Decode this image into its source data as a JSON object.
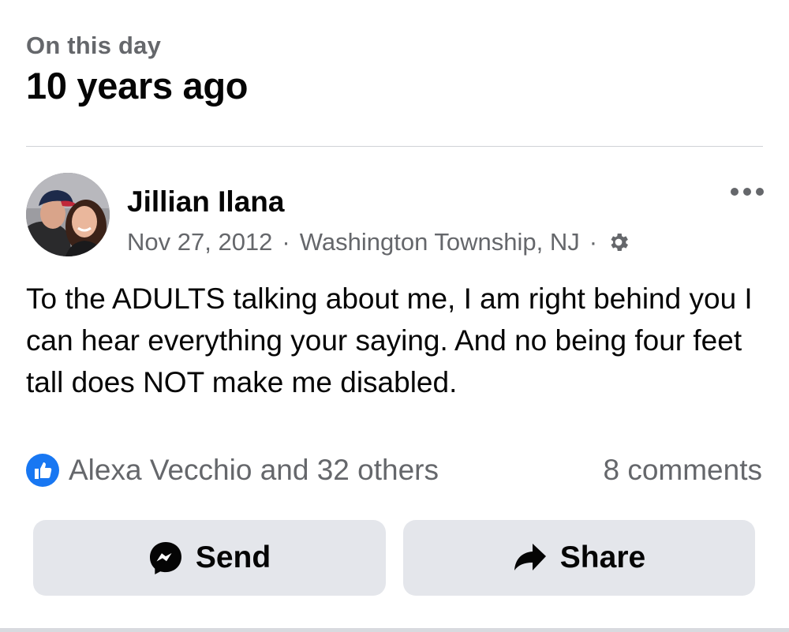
{
  "memory": {
    "kicker": "On this day",
    "title": "10 years ago"
  },
  "post": {
    "author": "Jillian Ilana",
    "date": "Nov 27, 2012",
    "location": "Washington Township, NJ",
    "separator": "·",
    "audience_icon": "gear-icon",
    "text": "To the ADULTS talking about me, I am right behind you I can hear everything your saying. And no being four feet tall does NOT make me disabled.",
    "more_icon": "more-dots-icon"
  },
  "engagement": {
    "reactions_text": "Alexa Vecchio and 32 others",
    "comments_text": "8 comments",
    "like_icon": "like-icon",
    "like_color": "#1877f2"
  },
  "actions": {
    "send_label": "Send",
    "send_icon": "messenger-icon",
    "share_label": "Share",
    "share_icon": "share-arrow-icon"
  },
  "colors": {
    "secondary_text": "#65676b",
    "button_bg": "#e4e6eb",
    "divider": "#d0d2d6"
  }
}
